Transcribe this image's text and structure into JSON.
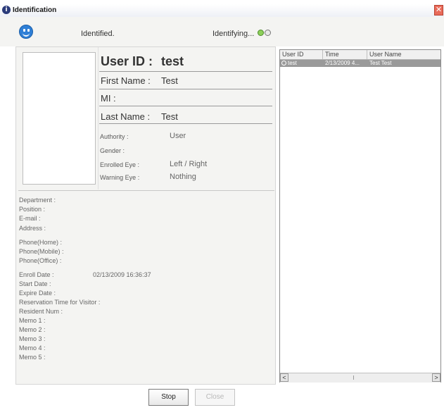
{
  "window": {
    "title": "Identification",
    "close_glyph": "✕"
  },
  "status": {
    "left_text": "Identified.",
    "right_text": "Identifying..."
  },
  "user": {
    "user_id_label": "User ID :",
    "user_id_value": "test",
    "first_name_label": "First Name :",
    "first_name_value": "Test",
    "mi_label": "MI :",
    "mi_value": "",
    "last_name_label": "Last Name :",
    "last_name_value": "Test",
    "authority_label": "Authority :",
    "authority_value": "User",
    "gender_label": "Gender :",
    "gender_value": "",
    "enrolled_eye_label": "Enrolled Eye :",
    "enrolled_eye_value": "Left / Right",
    "warning_eye_label": "Warning Eye :",
    "warning_eye_value": "Nothing"
  },
  "details": {
    "department": "Department :",
    "position": "Position :",
    "email": "E-mail :",
    "address": "Address :",
    "phone_home": "Phone(Home) :",
    "phone_mobile": "Phone(Mobile) :",
    "phone_office": "Phone(Office) :",
    "enroll_date": "Enroll Date :",
    "enroll_date_value": "02/13/2009 16:36:37",
    "start_date": "Start Date :",
    "expire_date": "Expire Date :",
    "reservation_time": "Reservation Time for Visitor :",
    "resident_num": "Resident Num :",
    "memo1": "Memo 1 :",
    "memo2": "Memo 2 :",
    "memo3": "Memo 3 :",
    "memo4": "Memo 4 :",
    "memo5": "Memo 5 :"
  },
  "list": {
    "columns": [
      "User ID",
      "Time",
      "User Name"
    ],
    "rows": [
      {
        "user_id": "test",
        "time": "2/13/2009 4...",
        "user_name": "Test Test"
      }
    ],
    "scroll_left": "<",
    "scroll_right": ">"
  },
  "buttons": {
    "stop": "Stop",
    "close": "Close"
  },
  "colors": {
    "accent": "#2f7fd6",
    "selected_row": "#9a9a9a",
    "indicator_on": "#8dcf5a"
  }
}
